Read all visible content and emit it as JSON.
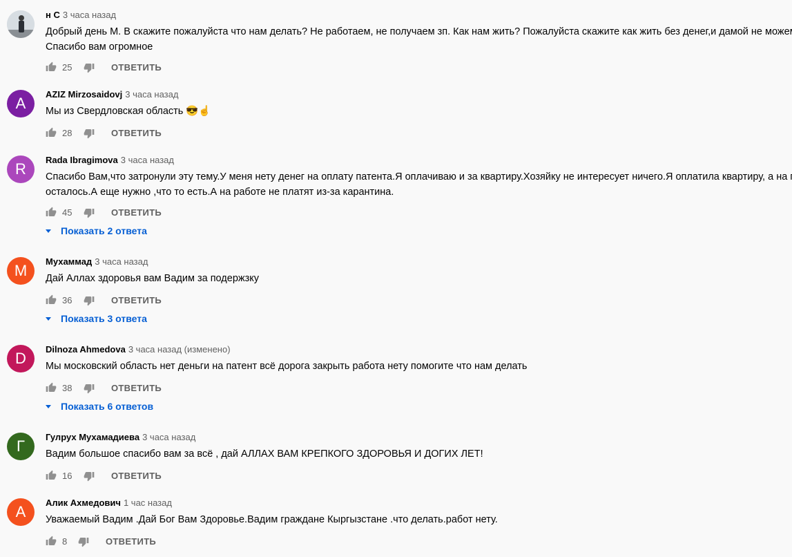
{
  "comments": [
    {
      "author": "н С",
      "time": "3 часа назад",
      "avatar_letter": "",
      "avatar_color": "#cfd6dc",
      "photo": true,
      "text": [
        "Добрый день М. В скажите пожалуйста что нам делать? Не работаем, не получаем зп. Как нам жить? Пожалуйста скажите как жить без денег,и дамой не можем по",
        "Спасибо вам огромное"
      ],
      "likes": "25",
      "reply_label": "ОТВЕТИТЬ",
      "replies": ""
    },
    {
      "author": "AZIZ Mirzosaidovj",
      "time": "3 часа назад",
      "avatar_letter": "A",
      "avatar_color": "#7b1fa2",
      "text": [
        "Мы из Свердловская область 😎☝"
      ],
      "likes": "28",
      "reply_label": "ОТВЕТИТЬ",
      "replies": ""
    },
    {
      "author": "Rada Ibragimova",
      "time": "3 часа назад",
      "avatar_letter": "R",
      "avatar_color": "#ab47bc",
      "text": [
        "Спасибо Вам,что затронули эту тему.У меня нету денег на оплату патента.Я оплачиваю и за квартиру.Хозяйку не интересует ничего.Я оплатила квартиру, а на патент",
        "осталось.А еще нужно ,что то есть.А на работе не платят из-за карантина."
      ],
      "likes": "45",
      "reply_label": "ОТВЕТИТЬ",
      "replies": "Показать 2 ответа"
    },
    {
      "author": "Мухаммад",
      "time": "3 часа назад",
      "avatar_letter": "M",
      "avatar_color": "#f4511e",
      "text": [
        "Дай Аллах здоровья вам Вадим за подержзку"
      ],
      "likes": "36",
      "reply_label": "ОТВЕТИТЬ",
      "replies": "Показать 3 ответа"
    },
    {
      "author": "Dilnoza Ahmedova",
      "time": "3 часа назад (изменено)",
      "avatar_letter": "D",
      "avatar_color": "#c2185b",
      "text": [
        "Мы московский область нет деньги на патент всё дорога закрыть работа нету помогите что нам делать"
      ],
      "likes": "38",
      "reply_label": "ОТВЕТИТЬ",
      "replies": "Показать 6 ответов"
    },
    {
      "author": "Гулрух Мухамадиева",
      "time": "3 часа назад",
      "avatar_letter": "Г",
      "avatar_color": "#33691e",
      "text": [
        "Вадим большое спасибо вам за всё , дай АЛЛАХ ВАМ КРЕПКОГО ЗДОРОВЬЯ И ДОГИХ ЛЕТ!"
      ],
      "likes": "16",
      "reply_label": "ОТВЕТИТЬ",
      "replies": ""
    },
    {
      "author": "Алик Ахмедович",
      "time": "1 час назад",
      "avatar_letter": "A",
      "avatar_color": "#f4511e",
      "text": [
        "Уважаемый Вадим .Дай Бог Вам Здоровье.Вадим граждане Кыргызстане .что делать.работ нету."
      ],
      "likes": "8",
      "reply_label": "ОТВЕТИТЬ",
      "replies": ""
    }
  ],
  "icons": {
    "like": "thumb-up-icon",
    "dislike": "thumb-down-icon",
    "expand": "caret-down-icon"
  },
  "colors": {
    "link": "#065fd4",
    "muted": "#606060",
    "background": "#f9f9f9"
  }
}
